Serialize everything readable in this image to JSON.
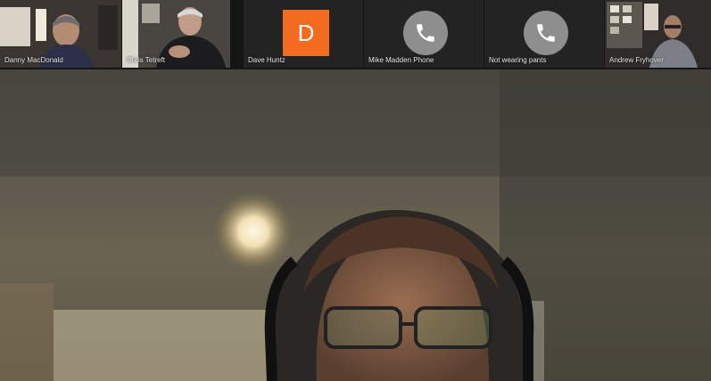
{
  "participants": [
    {
      "name": "Danny MacDonald",
      "type": "video"
    },
    {
      "name": "Chris Tetreft",
      "type": "video"
    },
    {
      "name": "Dave Huntz",
      "type": "avatar",
      "initial": "D",
      "color": "#f26b1f"
    },
    {
      "name": "Mike Madden Phone",
      "type": "phone",
      "icon": "phone-icon"
    },
    {
      "name": "Not wearing pants",
      "type": "phone",
      "icon": "phone-icon"
    },
    {
      "name": "Andrew Fryhover",
      "type": "video"
    }
  ],
  "main_speaker": {
    "type": "video"
  }
}
